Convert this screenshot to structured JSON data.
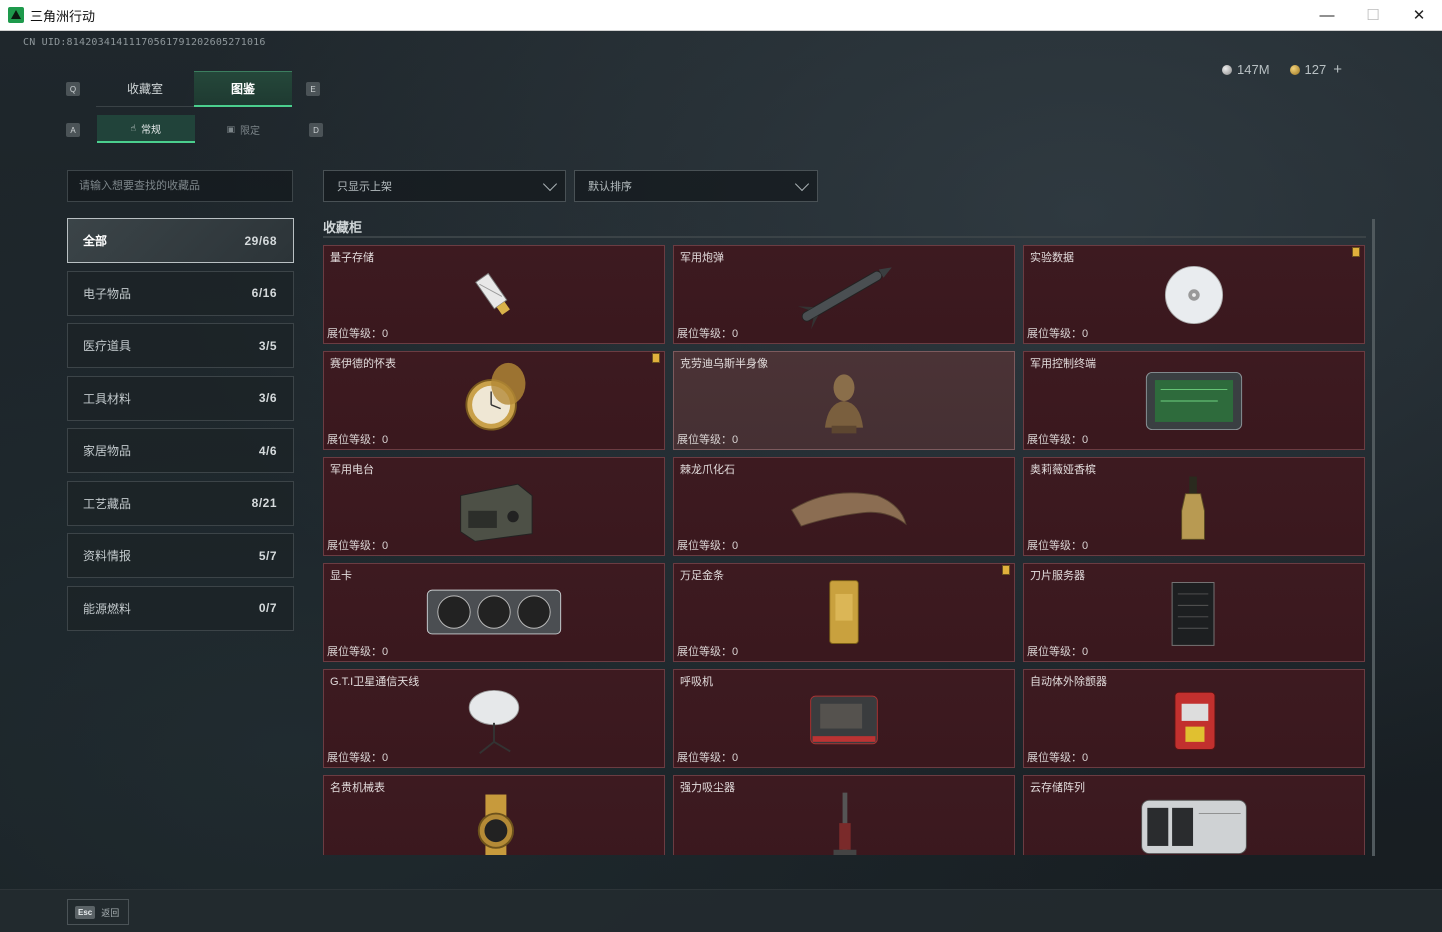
{
  "window": {
    "title": "三角洲行动",
    "minimize": "—",
    "maximize": "☐",
    "close": "✕"
  },
  "header": {
    "uid": "CN UID:814203414111705617912026052710​16",
    "currency": [
      {
        "icon": "silver-coin-icon",
        "value": "147M"
      },
      {
        "icon": "gold-coin-icon",
        "value": "127"
      }
    ],
    "add_label": "+"
  },
  "keys": {
    "main_prev": "Q",
    "main_next": "E",
    "sub_prev": "A",
    "sub_next": "D"
  },
  "main_tabs": [
    {
      "label": "收藏室",
      "active": false
    },
    {
      "label": "图鉴",
      "active": true
    }
  ],
  "sub_tabs": [
    {
      "label": "常规",
      "icon": "hand-icon",
      "active": true
    },
    {
      "label": "限定",
      "icon": "image-icon",
      "active": false
    }
  ],
  "search": {
    "placeholder": "请输入想要查找的收藏品"
  },
  "filters": {
    "shelf": "只显示上架",
    "sort": "默认排序"
  },
  "categories": [
    {
      "label": "全部",
      "count": "29/68",
      "active": true
    },
    {
      "label": "电子物品",
      "count": "6/16"
    },
    {
      "label": "医疗道具",
      "count": "3/5"
    },
    {
      "label": "工具材料",
      "count": "3/6"
    },
    {
      "label": "家居物品",
      "count": "4/6"
    },
    {
      "label": "工艺藏品",
      "count": "8/21"
    },
    {
      "label": "资料情报",
      "count": "5/7"
    },
    {
      "label": "能源燃料",
      "count": "0/7"
    }
  ],
  "section": {
    "title": "收藏柜"
  },
  "level_label": "展位等级：0",
  "items": [
    {
      "name": "量子存储",
      "badge": false,
      "icon": "usb-drive-icon"
    },
    {
      "name": "军用炮弹",
      "badge": false,
      "icon": "missile-icon"
    },
    {
      "name": "实验数据",
      "badge": true,
      "icon": "disc-icon"
    },
    {
      "name": "赛伊德的怀表",
      "badge": true,
      "icon": "pocket-watch-icon"
    },
    {
      "name": "克劳迪乌斯半身像",
      "badge": false,
      "icon": "bust-statue-icon",
      "highlight": true
    },
    {
      "name": "军用控制终端",
      "badge": false,
      "icon": "control-terminal-icon"
    },
    {
      "name": "军用电台",
      "badge": false,
      "icon": "radio-icon"
    },
    {
      "name": "棘龙爪化石",
      "badge": false,
      "icon": "claw-fossil-icon"
    },
    {
      "name": "奥莉薇娅香槟",
      "badge": false,
      "icon": "champagne-icon"
    },
    {
      "name": "显卡",
      "badge": false,
      "icon": "graphics-card-icon"
    },
    {
      "name": "万足金条",
      "badge": true,
      "icon": "gold-bar-icon"
    },
    {
      "name": "刀片服务器",
      "badge": false,
      "icon": "server-icon"
    },
    {
      "name": "G.T.I卫星通信天线",
      "badge": false,
      "icon": "satellite-dish-icon"
    },
    {
      "name": "呼吸机",
      "badge": false,
      "icon": "ventilator-icon"
    },
    {
      "name": "自动体外除颤器",
      "badge": false,
      "icon": "defibrillator-icon"
    },
    {
      "name": "名贵机械表",
      "badge": false,
      "icon": "wristwatch-icon"
    },
    {
      "name": "强力吸尘器",
      "badge": false,
      "icon": "vacuum-cleaner-icon"
    },
    {
      "name": "云存储阵列",
      "badge": false,
      "icon": "storage-array-icon"
    }
  ],
  "footer": {
    "esc_key": "Esc",
    "back_label": "返回"
  }
}
